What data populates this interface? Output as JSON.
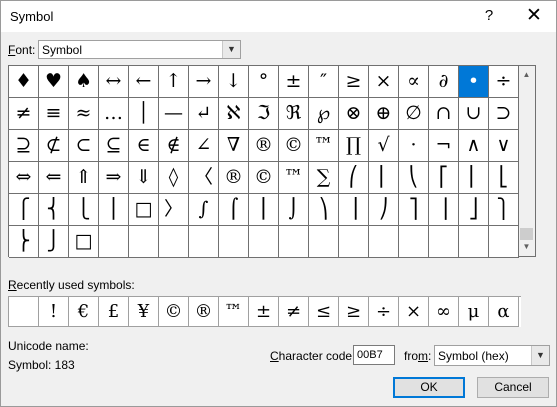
{
  "window": {
    "title": "Symbol",
    "help_label": "?",
    "close_label": "✕"
  },
  "font": {
    "label_u": "F",
    "label_rest": "ont:",
    "value": "Symbol"
  },
  "grid": {
    "selected_index": 14,
    "rows": [
      [
        "♦",
        "♥",
        "♠",
        "↔",
        "←",
        "↑",
        "→",
        "↓",
        "°",
        "±",
        "″",
        "≥",
        "×",
        "∝",
        "∂",
        "•",
        "÷"
      ],
      [
        "≠",
        "≡",
        "≈",
        "…",
        "│",
        "—",
        "↵",
        "ℵ",
        "ℑ",
        "ℜ",
        "℘",
        "⊗",
        "⊕",
        "∅",
        "∩",
        "∪",
        "⊃"
      ],
      [
        "⊇",
        "⊄",
        "⊂",
        "⊆",
        "∈",
        "∉",
        "∠",
        "∇",
        "®",
        "©",
        "™",
        "∏",
        "√",
        "·",
        "¬",
        "∧",
        "∨"
      ],
      [
        "⇔",
        "⇐",
        "⇑",
        "⇒",
        "⇓",
        "◊",
        "〈",
        "®",
        "©",
        "™",
        "∑",
        "⎛",
        "⎜",
        "⎝",
        "⎡",
        "⎢",
        "⎣"
      ],
      [
        "⎧",
        "⎨",
        "⎩",
        "⎪",
        "□",
        "〉",
        "∫",
        "⌠",
        "⎮",
        "⌡",
        "⎞",
        "⎟",
        "⎠",
        "⎤",
        "⎥",
        "⎦",
        "⎫"
      ],
      [
        "⎬",
        "⎭",
        "□",
        "",
        "",
        "",
        "",
        "",
        "",
        "",
        "",
        "",
        "",
        "",
        "",
        "",
        ""
      ]
    ]
  },
  "recent": {
    "label_u": "R",
    "label_rest": "ecently used symbols:",
    "symbols": [
      "",
      "!",
      "€",
      "£",
      "¥",
      "©",
      "®",
      "™",
      "±",
      "≠",
      "≤",
      "≥",
      "÷",
      "×",
      "∞",
      "μ",
      "α"
    ]
  },
  "unicode": {
    "name_label": "Unicode name:",
    "name_value": "Symbol: 183"
  },
  "charcode": {
    "label_u": "C",
    "label_rest": "haracter code:",
    "value": "00B7"
  },
  "from": {
    "label_pre": "fro",
    "label_u": "m",
    "label_post": ":",
    "value": "Symbol (hex)"
  },
  "buttons": {
    "ok": "OK",
    "cancel": "Cancel"
  },
  "icons": {
    "dropdown": "chevron-down-icon",
    "scroll_up": "triangle-up-icon",
    "scroll_down": "triangle-down-icon"
  },
  "colors": {
    "selection": "#0078d7",
    "ok_border": "#0078d7"
  }
}
